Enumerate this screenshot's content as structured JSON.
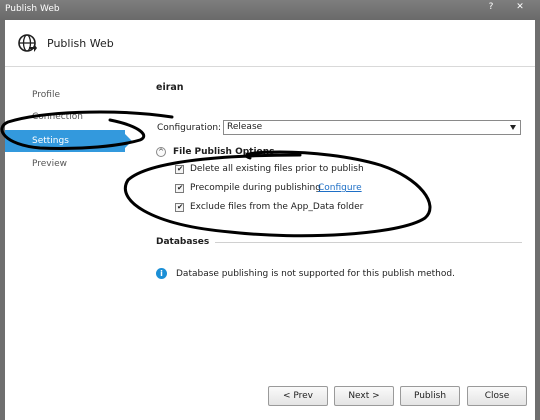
{
  "window": {
    "title": "Publish Web",
    "help_glyph": "?",
    "close_glyph": "✕"
  },
  "header": {
    "icon": "globe-icon",
    "title": "Publish Web"
  },
  "nav": {
    "items": [
      {
        "label": "Profile",
        "active": false
      },
      {
        "label": "Connection",
        "active": false
      },
      {
        "label": "Settings",
        "active": true
      },
      {
        "label": "Preview",
        "active": false
      }
    ]
  },
  "settings": {
    "profile_name": "eiran",
    "configuration_label": "Configuration:",
    "configuration_value": "Release",
    "file_publish_options_label": "File Publish Options",
    "options": [
      {
        "label": "Delete all existing files prior to publish",
        "checked": true
      },
      {
        "label": "Precompile during publishing",
        "checked": true,
        "link": "Configure"
      },
      {
        "label": "Exclude files from the App_Data folder",
        "checked": true
      }
    ],
    "databases_label": "Databases",
    "database_info": "Database publishing is not supported for this publish method.",
    "info_glyph": "i"
  },
  "footer": {
    "prev_label": "< Prev",
    "next_label": "Next >",
    "publish_label": "Publish",
    "close_label": "Close"
  },
  "colors": {
    "accent": "#3399dd",
    "link": "#1e6fc6",
    "titlebar": "#767676"
  }
}
